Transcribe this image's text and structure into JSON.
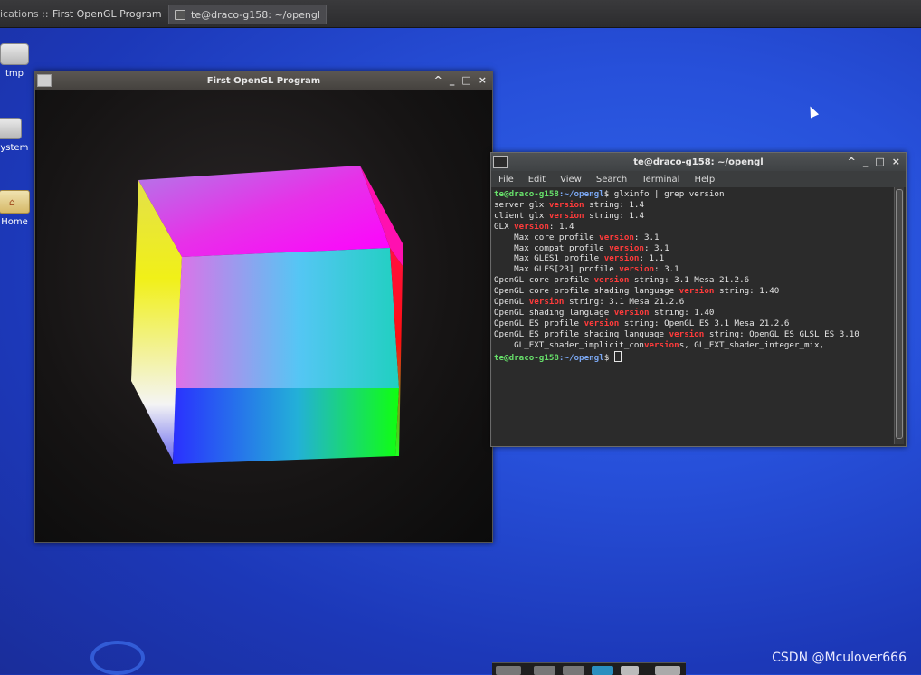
{
  "topbar": {
    "applications_label": "ications ::",
    "tasks": [
      {
        "label": "First OpenGL Program",
        "active": false
      },
      {
        "label": "te@draco-g158: ~/opengl",
        "active": true
      }
    ]
  },
  "desktop": {
    "icons": [
      {
        "label": "tmp"
      },
      {
        "label": "e System"
      },
      {
        "label": "Home"
      }
    ]
  },
  "gl_window": {
    "title": "First OpenGL Program",
    "buttons": [
      "^",
      "_",
      "□",
      "×"
    ]
  },
  "terminal": {
    "title": "te@draco-g158: ~/opengl",
    "menu": [
      "File",
      "Edit",
      "View",
      "Search",
      "Terminal",
      "Help"
    ],
    "prompt_user": "te@draco-g158",
    "prompt_path": ":~/opengl",
    "command": "$ glxinfo | grep version",
    "lines": [
      {
        "pre": "server glx ",
        "hl": "version",
        "post": " string: 1.4"
      },
      {
        "pre": "client glx ",
        "hl": "version",
        "post": " string: 1.4"
      },
      {
        "pre": "GLX ",
        "hl": "version",
        "post": ": 1.4"
      },
      {
        "pre": "    Max core profile ",
        "hl": "version",
        "post": ": 3.1"
      },
      {
        "pre": "    Max compat profile ",
        "hl": "version",
        "post": ": 3.1"
      },
      {
        "pre": "    Max GLES1 profile ",
        "hl": "version",
        "post": ": 1.1"
      },
      {
        "pre": "    Max GLES[23] profile ",
        "hl": "version",
        "post": ": 3.1"
      },
      {
        "pre": "OpenGL core profile ",
        "hl": "version",
        "post": " string: 3.1 Mesa 21.2.6"
      },
      {
        "pre": "OpenGL core profile shading language ",
        "hl": "version",
        "post": " string: 1.40"
      },
      {
        "pre": "OpenGL ",
        "hl": "version",
        "post": " string: 3.1 Mesa 21.2.6"
      },
      {
        "pre": "OpenGL shading language ",
        "hl": "version",
        "post": " string: 1.40"
      },
      {
        "pre": "OpenGL ES profile ",
        "hl": "version",
        "post": " string: OpenGL ES 3.1 Mesa 21.2.6"
      },
      {
        "pre": "OpenGL ES profile shading language ",
        "hl": "version",
        "post": " string: OpenGL ES GLSL ES 3.10"
      },
      {
        "pre": "    GL_EXT_shader_implicit_con",
        "hl": "version",
        "post": "s, GL_EXT_shader_integer_mix,"
      }
    ],
    "final_prompt_suffix": "$ "
  },
  "watermark": "CSDN @Mculover666",
  "colors": {
    "desktop_blue": "#2750da",
    "prompt_green": "#67e06a",
    "path_blue": "#7aa6f0",
    "highlight_red": "#ff3b3b"
  }
}
